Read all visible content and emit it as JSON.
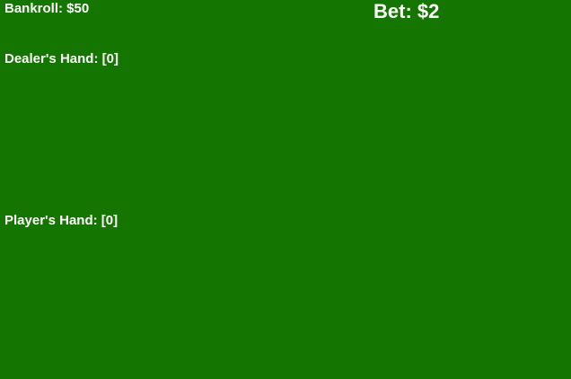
{
  "game": {
    "bankroll_text": "Bankroll: $50",
    "bet_text": "Bet: $2",
    "dealer_hand_text": "Dealer's Hand: [0]",
    "player_hand_text": "Player's Hand: [0]"
  },
  "colors": {
    "table_felt": "#147600",
    "text": "#ffffff"
  }
}
